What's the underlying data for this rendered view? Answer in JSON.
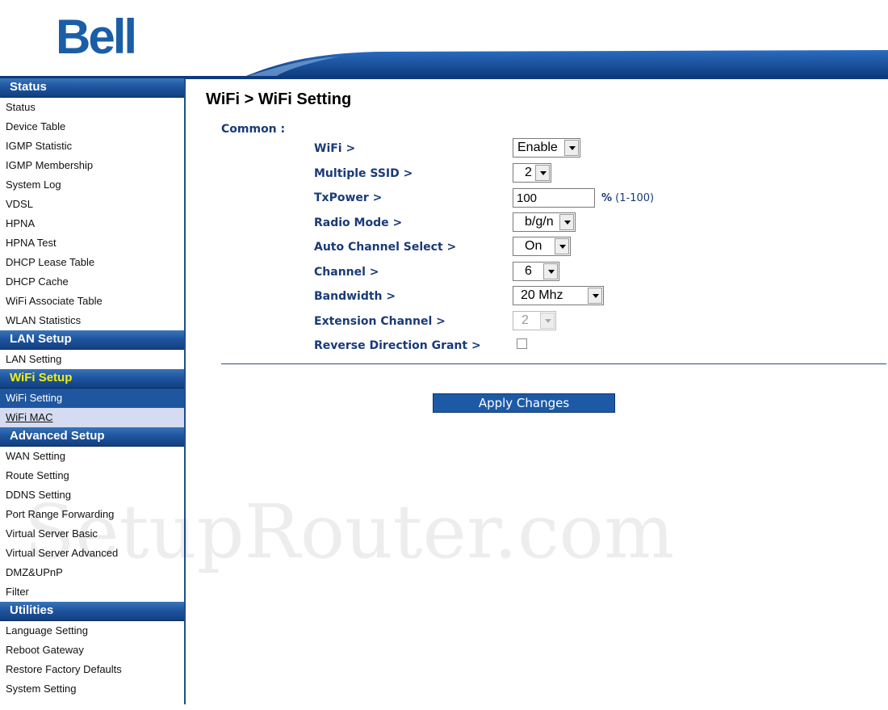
{
  "header": {
    "logo_text": "Bell",
    "brand_color": "#1a5ea8"
  },
  "sidebar": {
    "sections": [
      {
        "title": "Status",
        "items": [
          "Status",
          "Device Table",
          "IGMP Statistic",
          "IGMP Membership",
          "System Log",
          "VDSL",
          "HPNA",
          "HPNA Test",
          "DHCP Lease Table",
          "DHCP Cache",
          "WiFi Associate Table",
          "WLAN Statistics"
        ]
      },
      {
        "title": "LAN Setup",
        "items": [
          "LAN Setting"
        ]
      },
      {
        "title": "WiFi Setup",
        "items": [
          "WiFi Setting",
          "WiFi MAC"
        ]
      },
      {
        "title": "Advanced Setup",
        "items": [
          "WAN Setting",
          "Route Setting",
          "DDNS Setting",
          "Port Range Forwarding",
          "Virtual Server Basic",
          "Virtual Server Advanced",
          "DMZ&UPnP",
          "Filter"
        ]
      },
      {
        "title": "Utilities",
        "items": [
          "Language Setting",
          "Reboot Gateway",
          "Restore Factory Defaults",
          "System Setting"
        ]
      }
    ],
    "active_section": "WiFi Setup",
    "selected_item": "WiFi Setting",
    "hover_item": "WiFi MAC",
    "colors": {
      "header_blue": "#1f56a0",
      "active_text": "#f2f20a",
      "hover_bg": "#d5dbf0"
    }
  },
  "main": {
    "title": "WiFi > WiFi Setting",
    "common_label": "Common :",
    "fields": {
      "wifi": {
        "label": "WiFi >",
        "value": "Enable"
      },
      "multiple_ssid": {
        "label": "Multiple SSID >",
        "value": "2"
      },
      "txpower": {
        "label": "TxPower >",
        "value": "100",
        "unit": "%",
        "range": "(1-100)"
      },
      "radio_mode": {
        "label": "Radio Mode >",
        "value": "b/g/n"
      },
      "auto_channel": {
        "label": "Auto Channel Select >",
        "value": "On"
      },
      "channel": {
        "label": "Channel >",
        "value": "6"
      },
      "bandwidth": {
        "label": "Bandwidth >",
        "value": "20 Mhz"
      },
      "extension_channel": {
        "label": "Extension Channel >",
        "value": "2",
        "disabled": true
      },
      "reverse_direction_grant": {
        "label": "Reverse Direction Grant >",
        "checked": false
      }
    },
    "apply_label": "Apply Changes"
  },
  "watermark": "SetupRouter.com"
}
